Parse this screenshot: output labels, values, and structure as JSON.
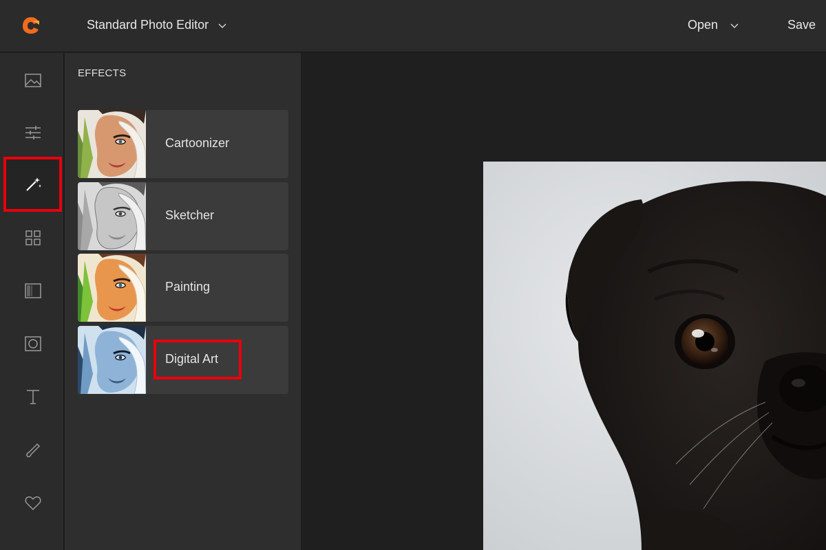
{
  "header": {
    "app_title": "Standard Photo Editor",
    "open_label": "Open",
    "save_label": "Save",
    "logo_color": "#f26b1d"
  },
  "toolbar": {
    "tools": [
      {
        "name": "image-icon",
        "active": false
      },
      {
        "name": "adjust-sliders-icon",
        "active": false
      },
      {
        "name": "magic-wand-icon",
        "active": true
      },
      {
        "name": "grid-icon",
        "active": false
      },
      {
        "name": "texture-icon",
        "active": false
      },
      {
        "name": "frame-icon",
        "active": false
      },
      {
        "name": "text-icon",
        "active": false
      },
      {
        "name": "brush-icon",
        "active": false
      },
      {
        "name": "heart-icon",
        "active": false
      }
    ],
    "highlight_color": "#e8000b"
  },
  "effects_panel": {
    "title": "EFFECTS",
    "items": [
      {
        "label": "Cartoonizer"
      },
      {
        "label": "Sketcher"
      },
      {
        "label": "Painting"
      },
      {
        "label": "Digital Art",
        "highlighted": true
      }
    ]
  },
  "canvas": {
    "image_subject": "pug-photo"
  }
}
